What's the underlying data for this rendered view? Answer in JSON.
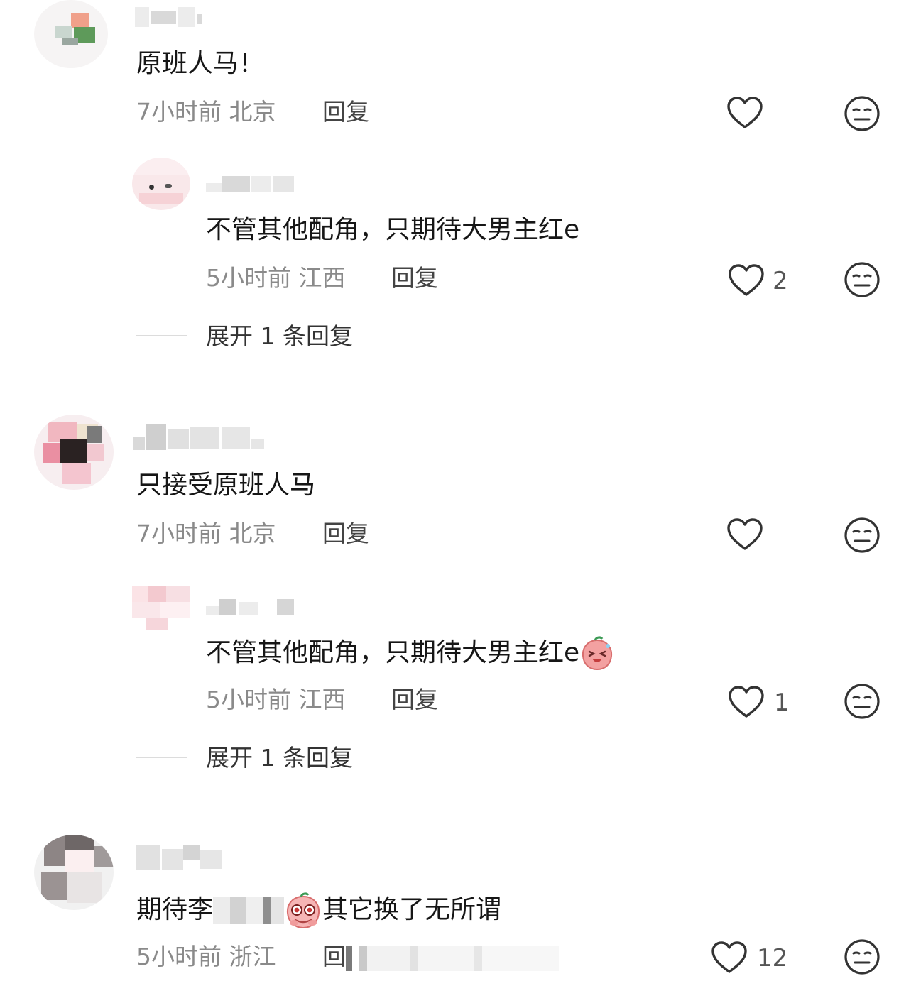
{
  "comments": [
    {
      "text": "原班人马！",
      "time": "7小时前",
      "location": "北京",
      "reply_label": "回复",
      "likes": "",
      "reply": {
        "text": "不管其他配角，只期待大男主红e",
        "time": "5小时前",
        "location": "江西",
        "reply_label": "回复",
        "likes": "2"
      },
      "expand_label": "展开 1 条回复"
    },
    {
      "text": "只接受原班人马",
      "time": "7小时前",
      "location": "北京",
      "reply_label": "回复",
      "likes": "",
      "reply": {
        "text": "不管其他配角，只期待大男主红e",
        "time": "5小时前",
        "location": "江西",
        "reply_label": "回复",
        "likes": "1"
      },
      "expand_label": "展开 1 条回复"
    },
    {
      "text_before": "期待李",
      "text_after": "其它换了无所谓",
      "time": "5小时前",
      "location": "浙江",
      "reply_label": "回",
      "likes": "12"
    }
  ],
  "icons": {
    "like": "heart-outline-icon",
    "dislike": "meh-face-icon",
    "emoji_laugh": "peach-laughing-emoji",
    "emoji_teary": "peach-teary-emoji"
  },
  "colors": {
    "text": "#161616",
    "meta": "#8a8a8a",
    "icon": "#333333"
  }
}
